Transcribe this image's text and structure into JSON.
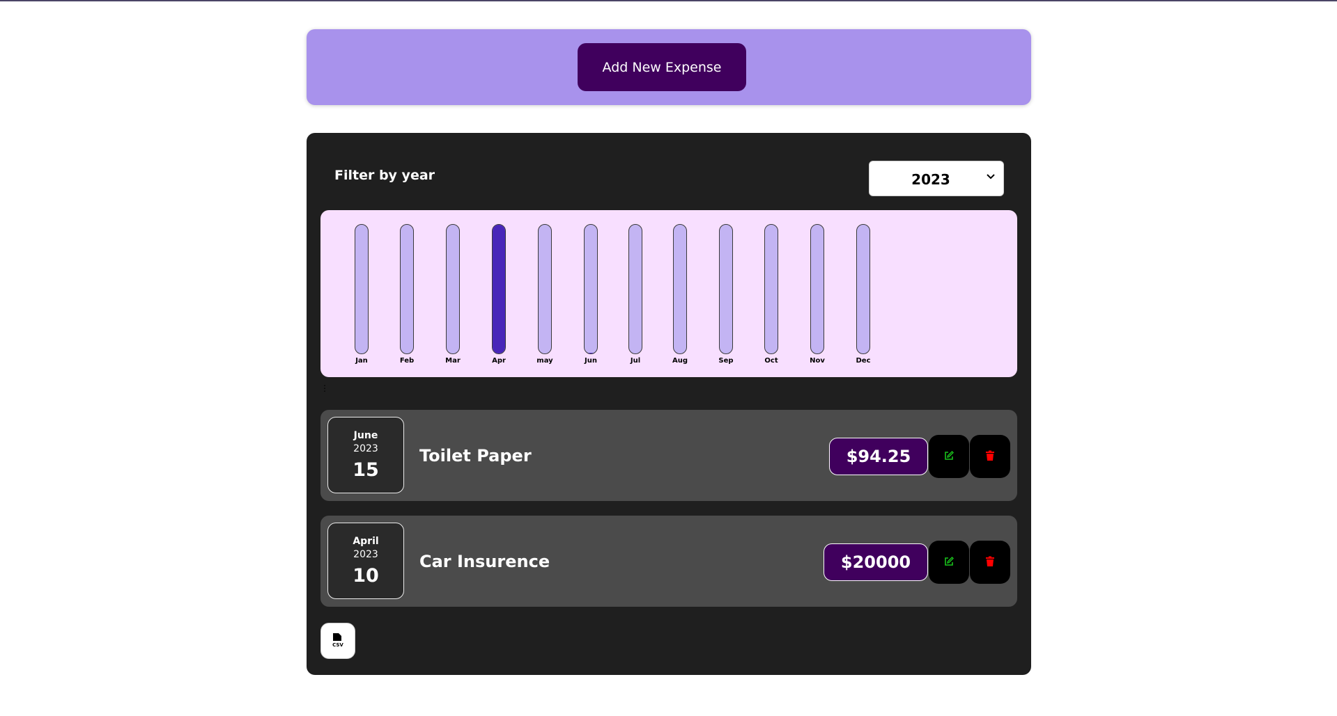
{
  "header": {
    "add_button_label": "Add New Expense"
  },
  "filter": {
    "label": "Filter by year",
    "selected_year": "2023"
  },
  "chart_data": {
    "type": "bar",
    "categories": [
      "Jan",
      "Feb",
      "Mar",
      "Apr",
      "may",
      "Jun",
      "Jul",
      "Aug",
      "Sep",
      "Oct",
      "Nov",
      "Dec"
    ],
    "values": [
      0,
      0,
      0,
      20000,
      0,
      94.25,
      0,
      0,
      0,
      0,
      0,
      0
    ],
    "ylim": [
      0,
      20000
    ],
    "grid": false,
    "colors": {
      "track": "#c3b4f3",
      "fill": "#4826b9",
      "background": "#f8dfff"
    }
  },
  "expenses": [
    {
      "month": "June",
      "year": "2023",
      "day": "15",
      "title": "Toilet Paper",
      "amount": "$94.25"
    },
    {
      "month": "April",
      "year": "2023",
      "day": "10",
      "title": "Car Insurence",
      "amount": "$20000"
    }
  ],
  "icons": {
    "edit": "edit-icon",
    "delete": "trash-icon",
    "export": "csv-file-icon"
  },
  "colors": {
    "accent": "#40005d",
    "header_bg": "#a892ec",
    "panel_bg": "#1f1f1f",
    "item_bg": "#4b4b4b",
    "edit_icon": "#19c21c",
    "delete_icon": "#ff0000"
  }
}
